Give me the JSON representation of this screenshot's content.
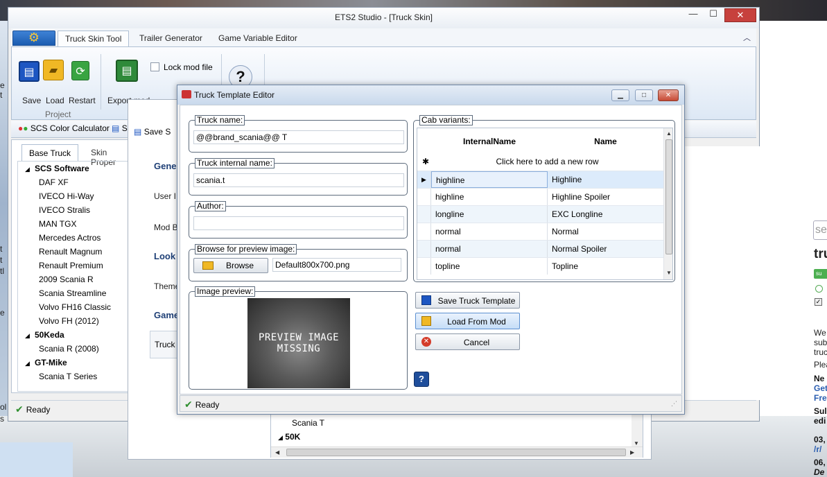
{
  "main_window": {
    "title": "ETS2 Studio - [Truck Skin]",
    "caption": {
      "minimize": "—",
      "maximize": "☐",
      "close": "✕"
    },
    "ribbon_tabs": [
      "Truck Skin Tool",
      "Trailer Generator",
      "Game Variable Editor"
    ],
    "ribbon": {
      "save_label": "Save",
      "load_label": "Load",
      "restart_label": "Restart",
      "export_label": "Export mod",
      "group_label": "Project",
      "lock_label": "Lock mod file",
      "help_glyph": "?"
    },
    "quick_bar": {
      "color_calc": "SCS Color Calculator",
      "s_label": "S"
    },
    "left_tabs": [
      "Base Truck",
      "Skin Proper"
    ],
    "tree": [
      {
        "group": "SCS Software",
        "items": [
          "DAF XF",
          "IVECO Hi-Way",
          "IVECO Stralis",
          "MAN TGX",
          "Mercedes Actros",
          "Renault Magnum",
          "Renault Premium",
          "2009 Scania R",
          "Scania Streamline",
          "Volvo FH16 Classic",
          "Volvo FH (2012)"
        ]
      },
      {
        "group": "50Keda",
        "items": [
          "Scania R (2008)"
        ]
      },
      {
        "group": "GT-Mike",
        "items": [
          "Scania T Series"
        ]
      }
    ],
    "status": "Ready"
  },
  "middle_window": {
    "save_label": "Save S",
    "labels": {
      "gene": "Gene",
      "user": "User I",
      "mod": "Mod B",
      "look": "Look",
      "theme": "Theme",
      "game": "Game",
      "truck": "Truck"
    },
    "list": {
      "item": "Scania T",
      "group": "50K"
    }
  },
  "dialog": {
    "title": "Truck Template Editor",
    "truck_name_label": "Truck name:",
    "truck_name_value": "@@brand_scania@@ T",
    "internal_name_label": "Truck internal name:",
    "internal_name_value": "scania.t",
    "author_label": "Author:",
    "author_value": "",
    "browse_group_label": "Browse for preview image:",
    "browse_button": "Browse",
    "preview_file": "Default800x700.png",
    "image_preview_label": "Image preview:",
    "preview_missing_line1": "PREVIEW IMAGE",
    "preview_missing_line2": "MISSING",
    "cab_variants_label": "Cab variants:",
    "grid_headers": {
      "internal": "InternalName",
      "name": "Name"
    },
    "new_row_text": "Click here to add a new row",
    "rows": [
      {
        "internal": "highline",
        "name": "Highline"
      },
      {
        "internal": "highline",
        "name": "Highline Spoiler"
      },
      {
        "internal": "longline",
        "name": "EXC Longline"
      },
      {
        "internal": "normal",
        "name": "Normal"
      },
      {
        "internal": "normal",
        "name": "Normal Spoiler"
      },
      {
        "internal": "topline",
        "name": "Topline"
      }
    ],
    "buttons": {
      "save": "Save Truck Template",
      "load": "Load From Mod",
      "cancel": "Cancel"
    },
    "status": "Ready"
  },
  "web_page": {
    "search": "se",
    "heading": "tru",
    "badge": "su",
    "lines": [
      "We",
      "sub",
      "truc",
      "Plea"
    ],
    "bold1": "Ne",
    "link1": "Get",
    "link2": "Fre",
    "bold2": "Sul",
    "bold2b": "edi",
    "date1": "03,",
    "link3": "/r/",
    "date2": "06,",
    "date2b": "De"
  },
  "edge_letters": [
    "e",
    "t",
    "t",
    "t",
    "tl",
    "e",
    "ol",
    "s"
  ]
}
